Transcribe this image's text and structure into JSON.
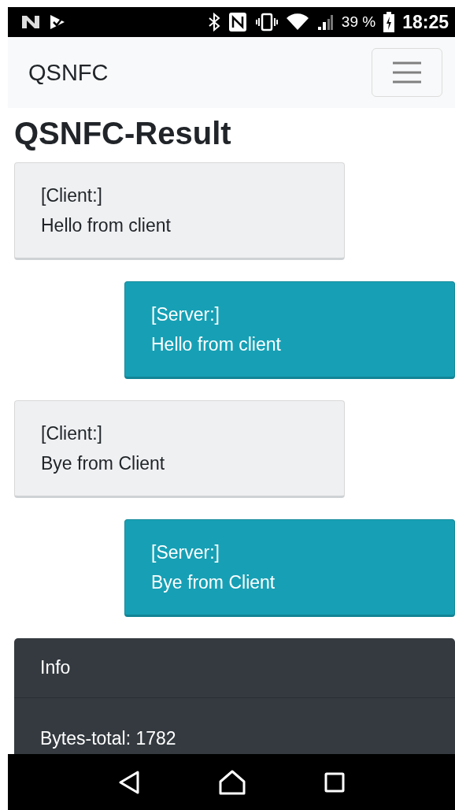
{
  "status_bar": {
    "battery": "39 %",
    "time": "18:25"
  },
  "navbar": {
    "brand": "QSNFC"
  },
  "title": "QSNFC-Result",
  "messages": [
    {
      "kind": "client",
      "sender": "[Client:]",
      "text": "Hello from client"
    },
    {
      "kind": "server",
      "sender": "[Server:]",
      "text": "Hello from client"
    },
    {
      "kind": "client",
      "sender": "[Client:]",
      "text": "Bye from Client"
    },
    {
      "kind": "server",
      "sender": "[Server:]",
      "text": "Bye from Client"
    }
  ],
  "info": {
    "header": "Info",
    "lines": [
      "Bytes-total: 1782"
    ]
  }
}
